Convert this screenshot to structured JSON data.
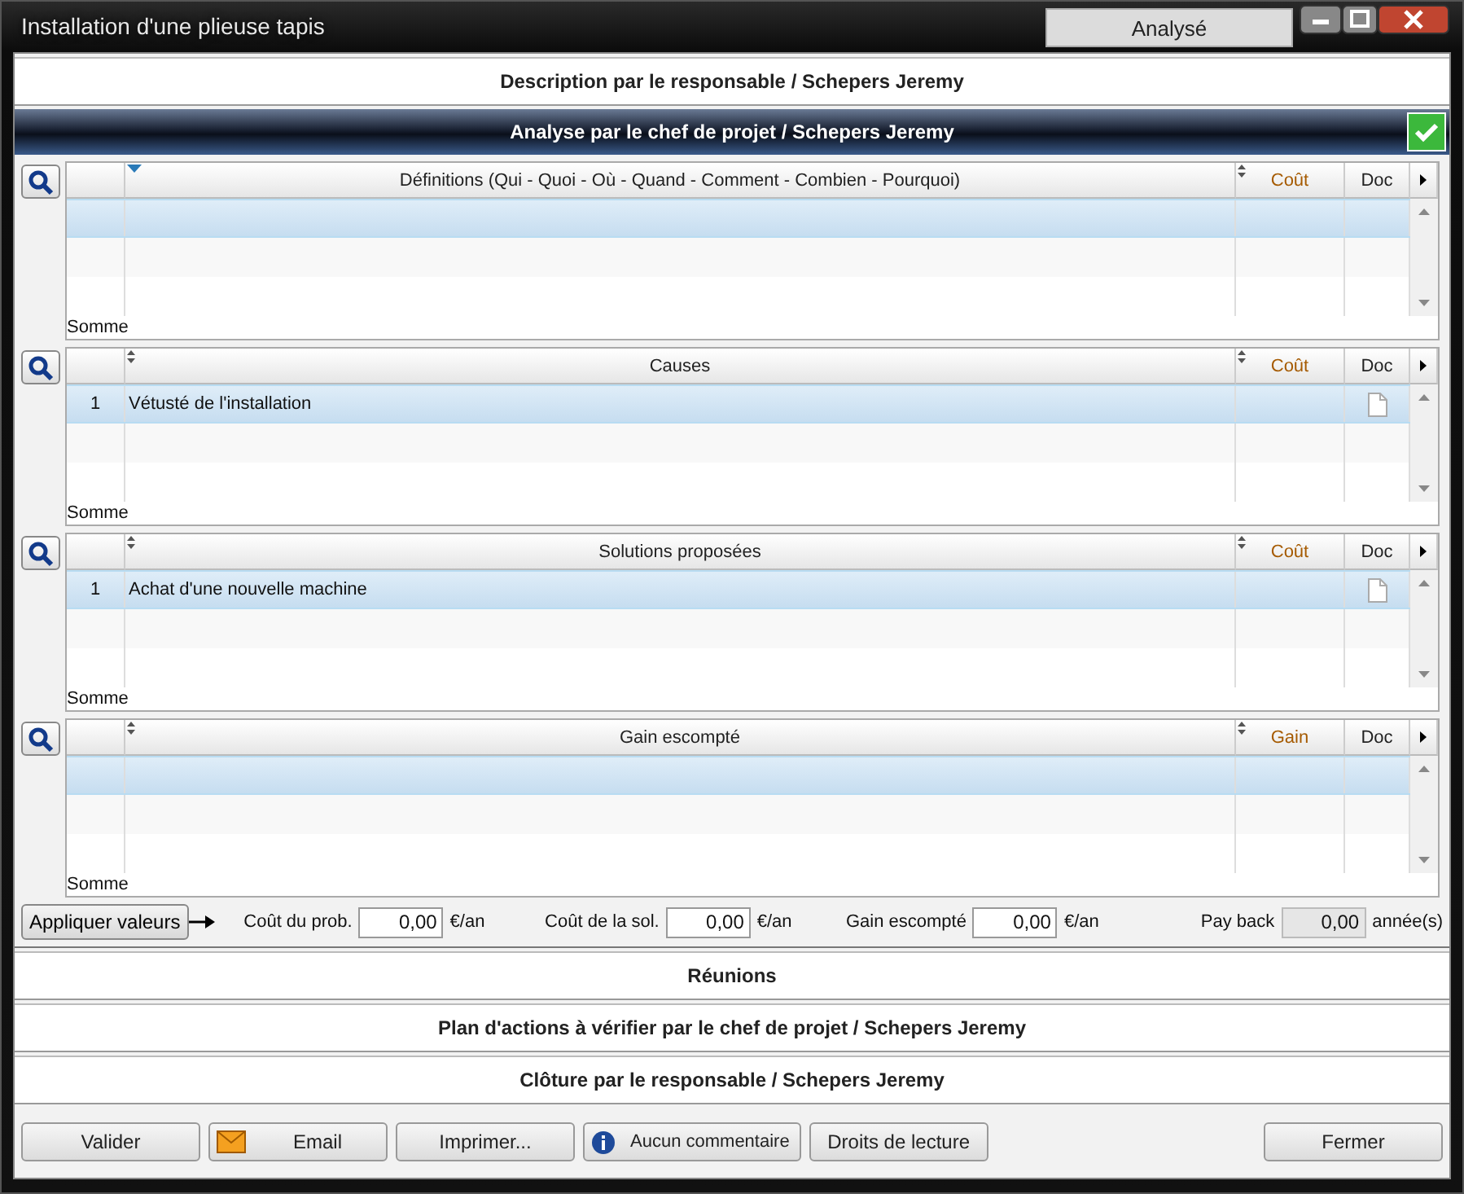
{
  "window": {
    "title": "Installation d'une plieuse tapis",
    "status": "Analysé"
  },
  "sections": [
    {
      "kind": "plain",
      "title": "Description par le responsable / Schepers Jeremy"
    },
    {
      "kind": "active",
      "title": "Analyse par le chef de projet / Schepers Jeremy",
      "validated": true,
      "grids": [
        {
          "sorted": true,
          "columns": [
            "Définitions (Qui - Quoi - Où - Quand - Comment - Combien - Pourquoi)",
            "Coût",
            "Doc"
          ],
          "rows": [
            {
              "selected": true,
              "has_doc": false
            }
          ],
          "footer": "Somme"
        },
        {
          "sorted": false,
          "columns": [
            "Causes",
            "Coût",
            "Doc"
          ],
          "rows": [
            {
              "number": "1",
              "text": "Vétusté de l'installation",
              "selected": true,
              "has_doc": true
            }
          ],
          "footer": "Somme"
        },
        {
          "sorted": false,
          "columns": [
            "Solutions proposées",
            "Coût",
            "Doc"
          ],
          "rows": [
            {
              "number": "1",
              "text": "Achat d'une nouvelle machine",
              "selected": true,
              "has_doc": true
            }
          ],
          "footer": "Somme"
        },
        {
          "sorted": false,
          "columns": [
            "Gain escompté",
            "Gain",
            "Doc"
          ],
          "rows": [
            {
              "selected": true,
              "has_doc": false
            }
          ],
          "footer": "Somme"
        }
      ],
      "apply_button": "Appliquer valeurs",
      "fields": [
        {
          "label": "Coût du prob.",
          "value": "0,00",
          "unit": "€/an",
          "disabled": false
        },
        {
          "label": "Coût de la sol.",
          "value": "0,00",
          "unit": "€/an",
          "disabled": false
        },
        {
          "label": "Gain escompté",
          "value": "0,00",
          "unit": "€/an",
          "disabled": false
        },
        {
          "label": "Pay back",
          "value": "0,00",
          "unit": "année(s)",
          "disabled": true
        }
      ]
    },
    {
      "kind": "plain",
      "title": "Réunions"
    },
    {
      "kind": "plain",
      "title": "Plan d'actions à vérifier par le chef de projet / Schepers Jeremy"
    },
    {
      "kind": "plain",
      "title": "Clôture par le responsable / Schepers Jeremy"
    }
  ],
  "buttons": [
    {
      "label": "Valider",
      "kind": "plain"
    },
    {
      "label": "Email",
      "kind": "mail"
    },
    {
      "label": "Imprimer...",
      "kind": "plain"
    },
    {
      "label": "Aucun commentaire",
      "kind": "info"
    },
    {
      "label": "Droits de lecture",
      "kind": "plain"
    },
    {
      "label": "Fermer",
      "kind": "plain"
    }
  ]
}
